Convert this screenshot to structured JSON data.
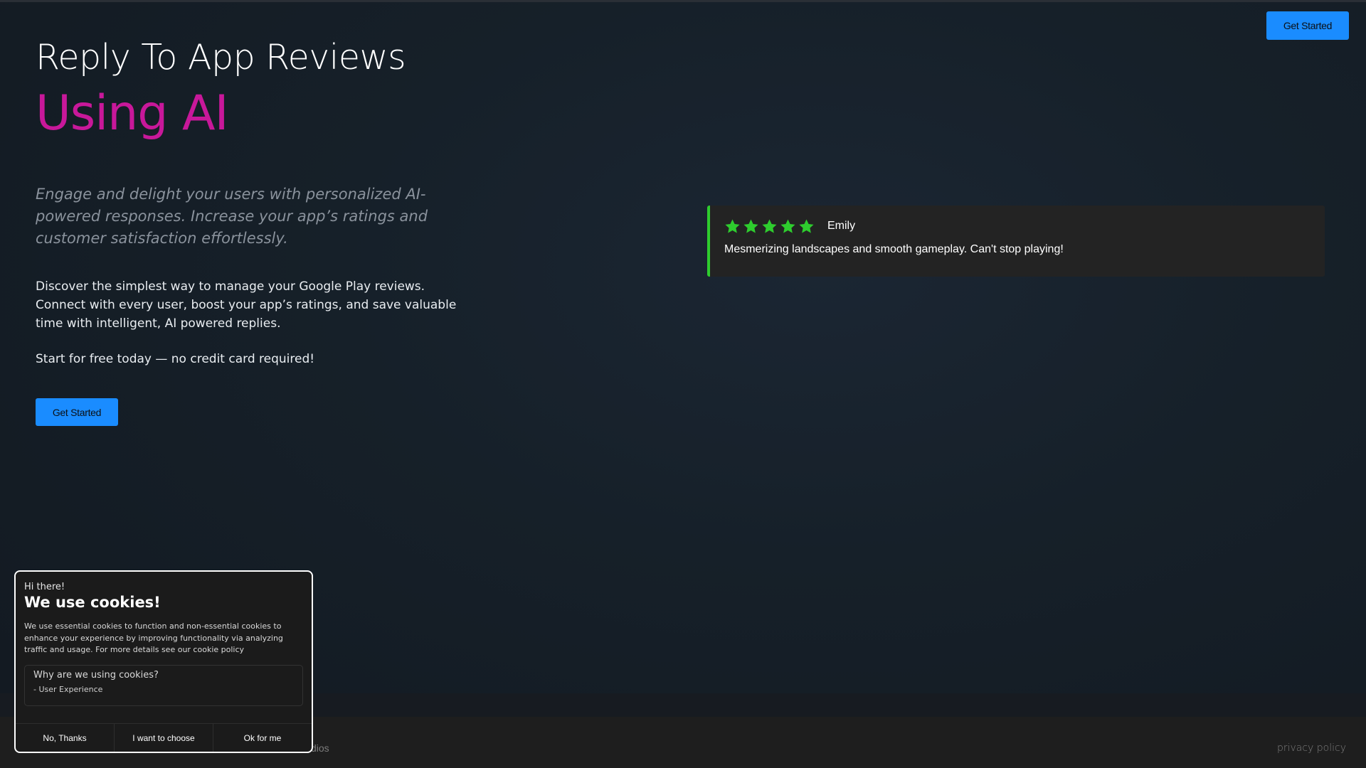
{
  "nav": {
    "cta_label": "Get Started"
  },
  "hero": {
    "title": "Reply To App Reviews",
    "accent": "Using AI",
    "lead": "Engage and delight your users with personalized AI-powered responses. Increase your app’s ratings and customer satisfaction effortlessly.",
    "body": "Discover the simplest way to manage your Google Play reviews. Connect with every user, boost your app’s ratings, and save valuable time with intelligent, AI powered replies.",
    "free": "Start for free today — no credit card required!",
    "cta_label": "Get Started"
  },
  "review": {
    "rating": 5,
    "author": "Emily",
    "text": "Mesmerizing landscapes and smooth gameplay. Can't stop playing!",
    "accent_color": "#2ecc2e"
  },
  "footer": {
    "copyright_visible": "dios",
    "privacy_label": "privacy policy"
  },
  "cookie": {
    "greeting": "Hi there!",
    "title": "We use cookies!",
    "description": "We use essential cookies to function and non-essential cookies to enhance your experience by improving functionality via analyzing traffic and usage. For more details see our cookie policy",
    "why_title": "Why are we using cookies?",
    "why_items": [
      "- User Experience"
    ],
    "buttons": {
      "reject": "No, Thanks",
      "choose": "I want to choose",
      "accept": "Ok for me"
    }
  },
  "colors": {
    "primary": "#1a8cff",
    "accent": "#c8189a",
    "star": "#2ecc2e"
  }
}
